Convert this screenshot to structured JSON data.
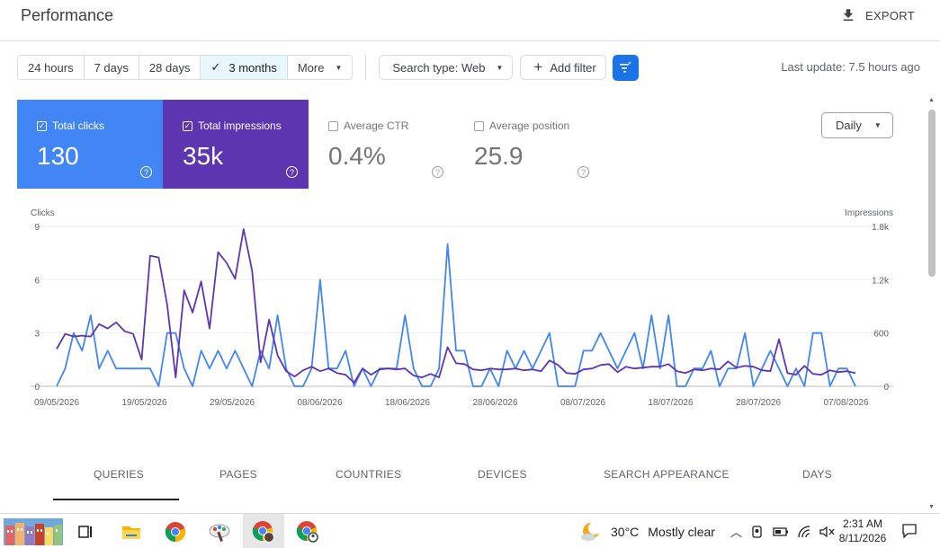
{
  "header": {
    "title": "Performance",
    "export_label": "EXPORT"
  },
  "date_ranges": [
    {
      "label": "24 hours",
      "active": false
    },
    {
      "label": "7 days",
      "active": false
    },
    {
      "label": "28 days",
      "active": false
    },
    {
      "label": "3 months",
      "active": true
    },
    {
      "label": "More",
      "active": false
    }
  ],
  "search_type": {
    "label": "Search type: Web"
  },
  "add_filter": {
    "label": "Add filter"
  },
  "last_update": "Last update: 7.5 hours ago",
  "metrics": {
    "clicks": {
      "label": "Total clicks",
      "value": "130",
      "checked": true,
      "color": "#4285f4"
    },
    "impressions": {
      "label": "Total impressions",
      "value": "35k",
      "checked": true,
      "color": "#5e35b1"
    },
    "ctr": {
      "label": "Average CTR",
      "value": "0.4%",
      "checked": false
    },
    "position": {
      "label": "Average position",
      "value": "25.9",
      "checked": false
    }
  },
  "granularity": {
    "label": "Daily"
  },
  "chart_data": {
    "type": "line",
    "left_axis_label": "Clicks",
    "right_axis_label": "Impressions",
    "left_ticks": [
      "9",
      "6",
      "3",
      "0"
    ],
    "right_ticks": [
      "1.8k",
      "1.2k",
      "600",
      "0"
    ],
    "ylim_left": [
      0,
      9
    ],
    "ylim_right": [
      0,
      1800
    ],
    "x_tick_labels": [
      "09/05/2026",
      "19/05/2026",
      "29/05/2026",
      "08/06/2026",
      "18/06/2026",
      "28/06/2026",
      "08/07/2026",
      "18/07/2026",
      "28/07/2026",
      "07/08/2026"
    ],
    "series": [
      {
        "name": "Clicks",
        "color": "#4285f4",
        "values": [
          0,
          1,
          3,
          2,
          4,
          1,
          2,
          1,
          1,
          1,
          1,
          1,
          0,
          3,
          3,
          1,
          0,
          2,
          1,
          2,
          1,
          2,
          1,
          0,
          2,
          1,
          4,
          1,
          0,
          0,
          1,
          6,
          1,
          1,
          2,
          0,
          1,
          0,
          1,
          1,
          1,
          4,
          1,
          0,
          0,
          1,
          8,
          2,
          2,
          0,
          0,
          1,
          0,
          2,
          1,
          2,
          1,
          2,
          3,
          0,
          0,
          0,
          2,
          2,
          3,
          2,
          1,
          2,
          3,
          1,
          4,
          1,
          4,
          0,
          0,
          1,
          1,
          2,
          0,
          1,
          1,
          3,
          0,
          1,
          2,
          1,
          0,
          1,
          0,
          3,
          3,
          0,
          1,
          1,
          0
        ]
      },
      {
        "name": "Impressions",
        "color": "#5e35b1",
        "values": [
          420,
          590,
          560,
          570,
          560,
          700,
          650,
          720,
          620,
          590,
          300,
          1470,
          1450,
          920,
          100,
          1080,
          830,
          1180,
          650,
          1510,
          1390,
          1210,
          1770,
          1300,
          270,
          750,
          350,
          170,
          110,
          180,
          220,
          170,
          200,
          150,
          130,
          40,
          200,
          130,
          190,
          200,
          190,
          200,
          120,
          100,
          140,
          100,
          440,
          260,
          250,
          190,
          180,
          200,
          190,
          190,
          200,
          180,
          190,
          170,
          290,
          240,
          150,
          140,
          190,
          200,
          240,
          250,
          160,
          220,
          200,
          210,
          220,
          220,
          250,
          170,
          150,
          190,
          180,
          200,
          190,
          280,
          210,
          230,
          220,
          180,
          170,
          530,
          150,
          130,
          230,
          140,
          130,
          180,
          160,
          170,
          150
        ]
      }
    ]
  },
  "tabs": [
    {
      "label": "QUERIES",
      "active": true
    },
    {
      "label": "PAGES",
      "active": false
    },
    {
      "label": "COUNTRIES",
      "active": false
    },
    {
      "label": "DEVICES",
      "active": false
    },
    {
      "label": "SEARCH APPEARANCE",
      "active": false
    },
    {
      "label": "DAYS",
      "active": false
    }
  ],
  "taskbar": {
    "weather_temp": "30°C",
    "weather_desc": "Mostly clear",
    "time": "2:31 AM",
    "date": "8/11/2026",
    "icons": [
      "desktop-thumbnail-icon",
      "task-view-icon",
      "file-explorer-icon",
      "chrome-icon",
      "paint-icon",
      "chrome-profile-icon",
      "chrome-profile-2-icon"
    ]
  }
}
